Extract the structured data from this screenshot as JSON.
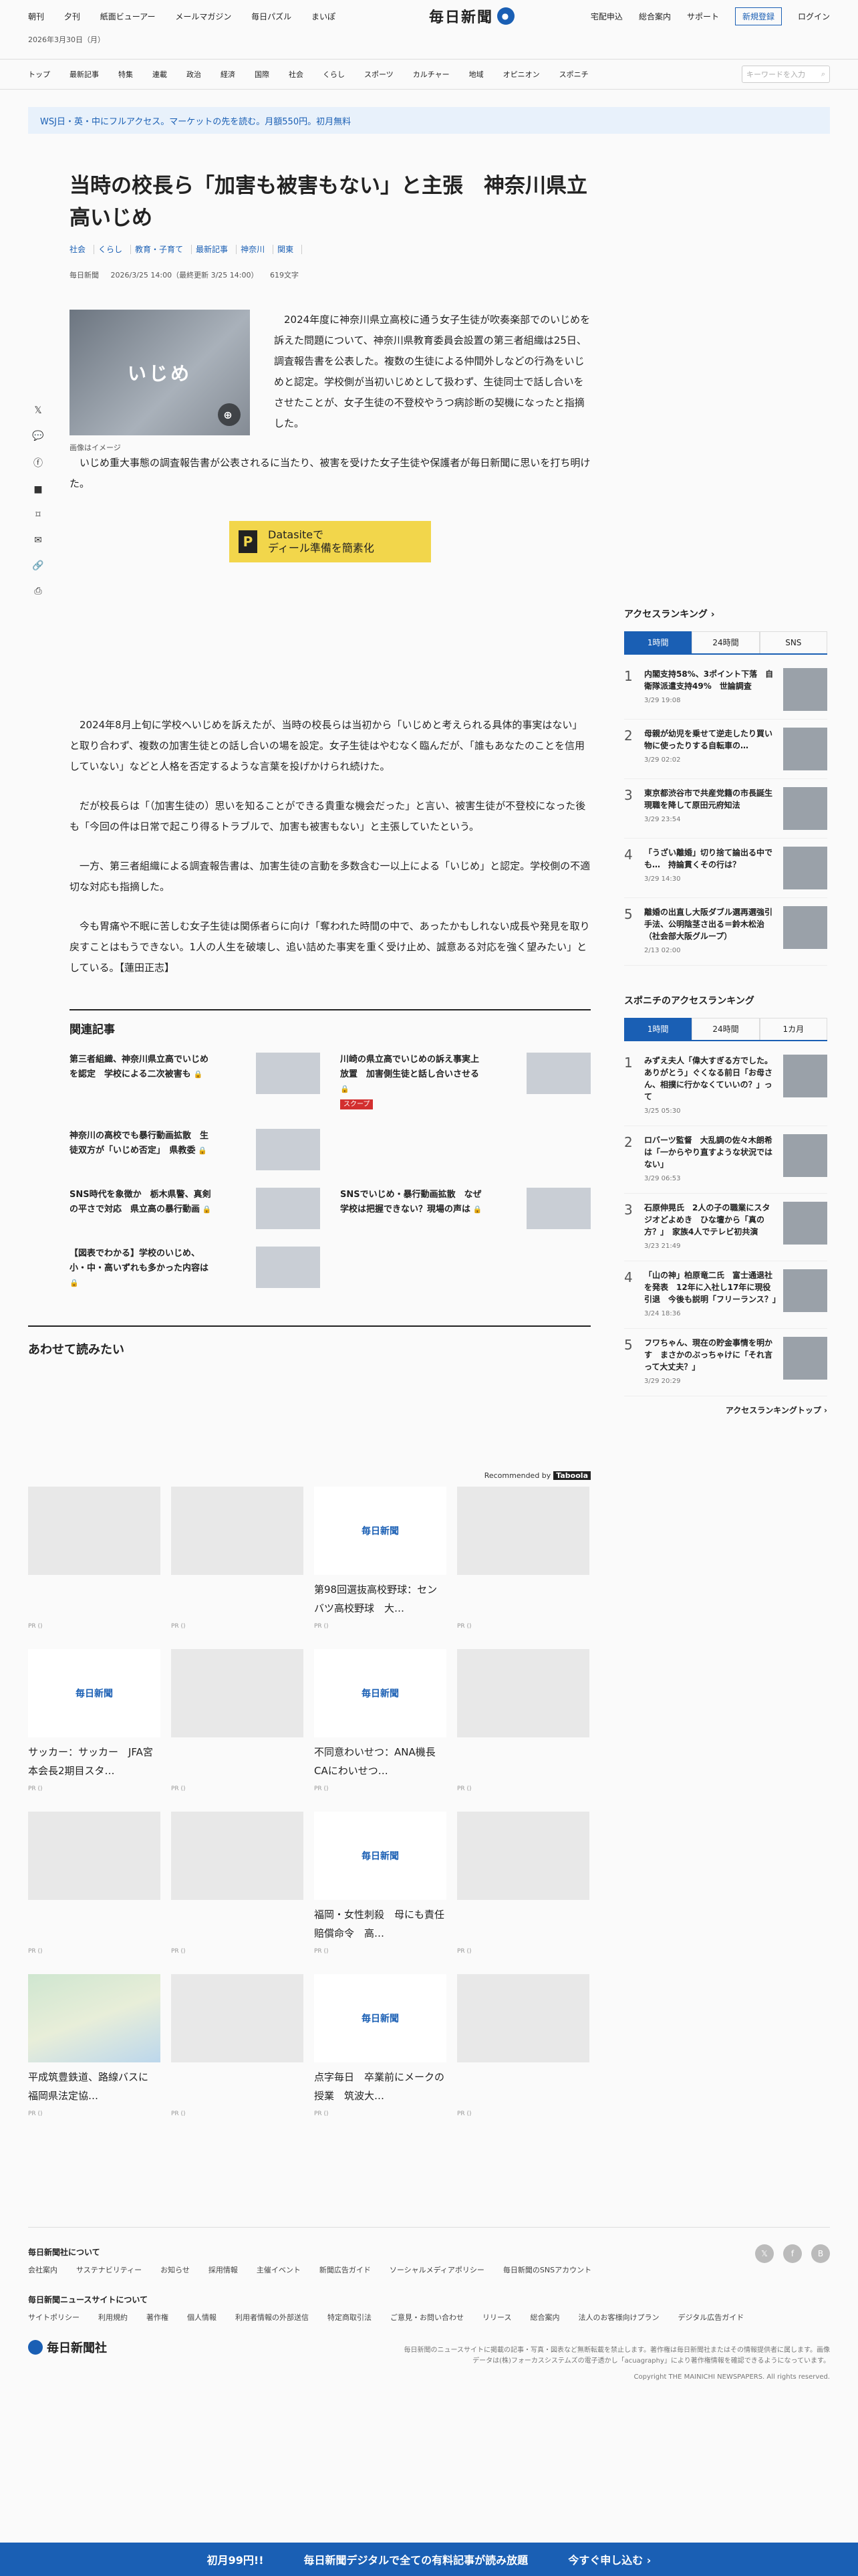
{
  "header": {
    "links": [
      "朝刊",
      "夕刊",
      "紙面ビューアー",
      "メールマガジン",
      "毎日パズル",
      "まいぽ"
    ],
    "logo": "毎日新聞",
    "right_links": [
      "宅配申込",
      "総合案内",
      "サポート"
    ],
    "register": "新規登録",
    "login": "ログイン",
    "date": "2026年3月30日（月）"
  },
  "nav": {
    "items": [
      "トップ",
      "最新記事",
      "特集",
      "連載",
      "政治",
      "経済",
      "国際",
      "社会",
      "くらし",
      "スポーツ",
      "カルチャー",
      "地域",
      "オピニオン",
      "スポニチ"
    ],
    "search_placeholder": "キーワードを入力"
  },
  "promo": "WSJ日・英・中にフルアクセス。マーケットの先を読む。月額550円。初月無料",
  "article": {
    "title": "当時の校長ら「加害も被害もない」と主張　神奈川県立高いじめ",
    "tags": [
      "社会",
      "くらし",
      "教育・子育て",
      "最新記事",
      "神奈川",
      "関東"
    ],
    "source": "毎日新聞",
    "published": "2026/3/25 14:00（最終更新 3/25 14:00）",
    "length": "619文字",
    "image_text": "いじめ",
    "caption": "画像はイメージ",
    "lead": "2024年度に神奈川県立高校に通う女子生徒が吹奏楽部でのいじめを訴えた問題について、神奈川県教育委員会設置の第三者組織は25日、調査報告書を公表した。複数の生徒による仲間外しなどの行為をいじめと認定。学校側が当初いじめとして扱わず、生徒同士で話し合いをさせたことが、女子生徒の不登校やうつ病診断の契機になったと指摘した。",
    "p1": "いじめ重大事態の調査報告書が公表されるに当たり、被害を受けた女子生徒や保護者が毎日新聞に思いを打ち明けた。",
    "ad_text": "Datasiteで\nディール準備を簡素化",
    "ad_letter": "P",
    "p2": "2024年8月上旬に学校へいじめを訴えたが、当時の校長らは当初から「いじめと考えられる具体的事実はない」と取り合わず、複数の加害生徒との話し合いの場を設定。女子生徒はやむなく臨んだが、「誰もあなたのことを信用していない」などと人格を否定するような言葉を投げかけられ続けた。",
    "p3": "だが校長らは「（加害生徒の）思いを知ることができる貴重な機会だった」と言い、被害生徒が不登校になった後も「今回の件は日常で起こり得るトラブルで、加害も被害もない」と主張していたという。",
    "p4": "一方、第三者組織による調査報告書は、加害生徒の言動を多数含む一以上による「いじめ」と認定。学校側の不適切な対応も指摘した。",
    "p5": "今も胃痛や不眠に苦しむ女子生徒は関係者らに向け「奪われた時間の中で、あったかもしれない成長や発見を取り戻すことはもうできない。1人の人生を破壊し、追い詰めた事実を重く受け止め、誠意ある対応を強く望みたい」としている。【蓮田正志】"
  },
  "share_icons": [
    "x-icon",
    "comment-icon",
    "facebook-icon",
    "hatena-icon",
    "bookmark-icon",
    "mail-icon",
    "link-icon",
    "print-icon"
  ],
  "related": {
    "heading": "関連記事",
    "items": [
      {
        "title": "第三者組織、神奈川県立高でいじめを認定　学校による二次被害も",
        "scoop": ""
      },
      {
        "title": "川崎の県立高でいじめの訴え事実上放置　加害側生徒と話し合いさせる",
        "scoop": "スクープ"
      },
      {
        "title": "神奈川の高校でも暴行動画拡散　生徒双方が「いじめ否定」　県教委",
        "scoop": ""
      },
      {
        "title": "",
        "scoop": ""
      },
      {
        "title": "SNS時代を象徴か　栃木県警、真剣の平さで対応　県立高の暴行動画",
        "scoop": ""
      },
      {
        "title": "SNSでいじめ・暴行動画拡散　なぜ学校は把握できない？現場の声は",
        "scoop": ""
      },
      {
        "title": "【図表でわかる】学校のいじめ、小・中・高いずれも多かった内容は",
        "scoop": ""
      }
    ]
  },
  "awase": {
    "heading": "あわせて読みたい",
    "recommended": "Recommended by",
    "brand": "Taboola",
    "pr": "PR ()",
    "items": [
      {
        "title": "",
        "kind": "blank"
      },
      {
        "title": "",
        "kind": "blank"
      },
      {
        "title": "第98回選抜高校野球：センバツ高校野球　大…",
        "kind": "logo"
      },
      {
        "title": "",
        "kind": "blank"
      },
      {
        "title": "サッカー：サッカー　JFA宮本会長2期目スタ…",
        "kind": "logo"
      },
      {
        "title": "",
        "kind": "blank"
      },
      {
        "title": "不同意わいせつ：ANA機長　CAにわいせつ…",
        "kind": "logo"
      },
      {
        "title": "",
        "kind": "blank"
      },
      {
        "title": "",
        "kind": "blank"
      },
      {
        "title": "",
        "kind": "blank"
      },
      {
        "title": "福岡・女性刺殺　母にも責任　賠償命令　高…",
        "kind": "logo"
      },
      {
        "title": "",
        "kind": "blank"
      },
      {
        "title": "平成筑豊鉄道、路線バスに　福岡県法定協…",
        "kind": "map"
      },
      {
        "title": "",
        "kind": "blank"
      },
      {
        "title": "点字毎日　卒業前にメークの授業　筑波大…",
        "kind": "logo"
      },
      {
        "title": "",
        "kind": "blank"
      }
    ]
  },
  "ranking": {
    "heading": "アクセスランキング",
    "tabs": [
      "1時間",
      "24時間",
      "SNS"
    ],
    "items": [
      {
        "title": "内閣支持58%、3ポイント下落　自衛隊派遣支持49%　世論調査",
        "date": "3/29 19:08"
      },
      {
        "title": "母親が幼児を乗せて逆走したり買い物に使ったりする自転車の…",
        "date": "3/29 02:02"
      },
      {
        "title": "東京都渋谷市で共産党籍の市長誕生　現職を降して原田元府知法",
        "date": "3/29 23:54"
      },
      {
        "title": "「うざい離婚」切り捨て論出る中でも…　持論貫くその行は？",
        "date": "3/29 14:30"
      },
      {
        "title": "離婚の出直し大阪ダブル選再選強引手法、公明陰茎さ出る＝鈴木松治（社会部大阪グループ）",
        "date": "2/13 02:00"
      }
    ]
  },
  "sponichi": {
    "heading": "スポニチのアクセスランキング",
    "tabs": [
      "1時間",
      "24時間",
      "1カ月"
    ],
    "more": "アクセスランキングトップ",
    "items": [
      {
        "title": "みずえ夫人「偉大すぎる方でした。ありがとう」ぐくなる前日「お母さん、相撲に行かなくていいの？」って",
        "date": "3/25 05:30"
      },
      {
        "title": "ロバーツ監督　大乱調の佐々木朗希は「一からやり直すような状況ではない」",
        "date": "3/29 06:53"
      },
      {
        "title": "石原伸晃氏　2人の子の職業にスタジオどよめき　ひな壇から「真の方？」　家族4人でテレビ初共演",
        "date": "3/23 21:49"
      },
      {
        "title": "「山の神」柏原竜二氏　富士通退社を発表　12年に入社し17年に現役引退　今後も説明「フリーランス？」",
        "date": "3/24 18:36"
      },
      {
        "title": "フワちゃん、現在の貯金事情を明かす　まさかのぶっちゃけに「それ言って大丈夫？」",
        "date": "3/29 20:29"
      }
    ]
  },
  "footer": {
    "sec1": "毎日新聞社について",
    "links1": [
      "会社案内",
      "サステナビリティー",
      "お知らせ",
      "採用情報",
      "主催イベント",
      "新聞広告ガイド",
      "ソーシャルメディアポリシー",
      "毎日新聞のSNSアカウント"
    ],
    "sec2": "毎日新聞ニュースサイトについて",
    "links2": [
      "サイトポリシー",
      "利用規約",
      "著作権",
      "個人情報",
      "利用者情報の外部送信",
      "特定商取引法",
      "ご意見・お問い合わせ",
      "リリース",
      "総合案内",
      "法人のお客様向けプラン",
      "デジタル広告ガイド"
    ],
    "logo": "毎日新聞社",
    "note": "毎日新聞のニュースサイトに掲載の記事・写真・図表など無断転載を禁止します。著作権は毎日新聞社またはその情報提供者に属します。画像データは(株)フォーカスシステムズの電子透かし「acuagraphy」により著作権情報を確認できるようになっています。",
    "copyright": "Copyright THE MAINICHI NEWSPAPERS. All rights reserved."
  },
  "bottombar": {
    "left": "初月99円!!",
    "mid": "毎日新聞デジタルで全ての有料記事が読み放題",
    "right": "今すぐ申し込む ›"
  },
  "colors": {
    "brand": "#1a5fb4",
    "ad": "#f2d64b",
    "scoop": "#d32f2f"
  }
}
